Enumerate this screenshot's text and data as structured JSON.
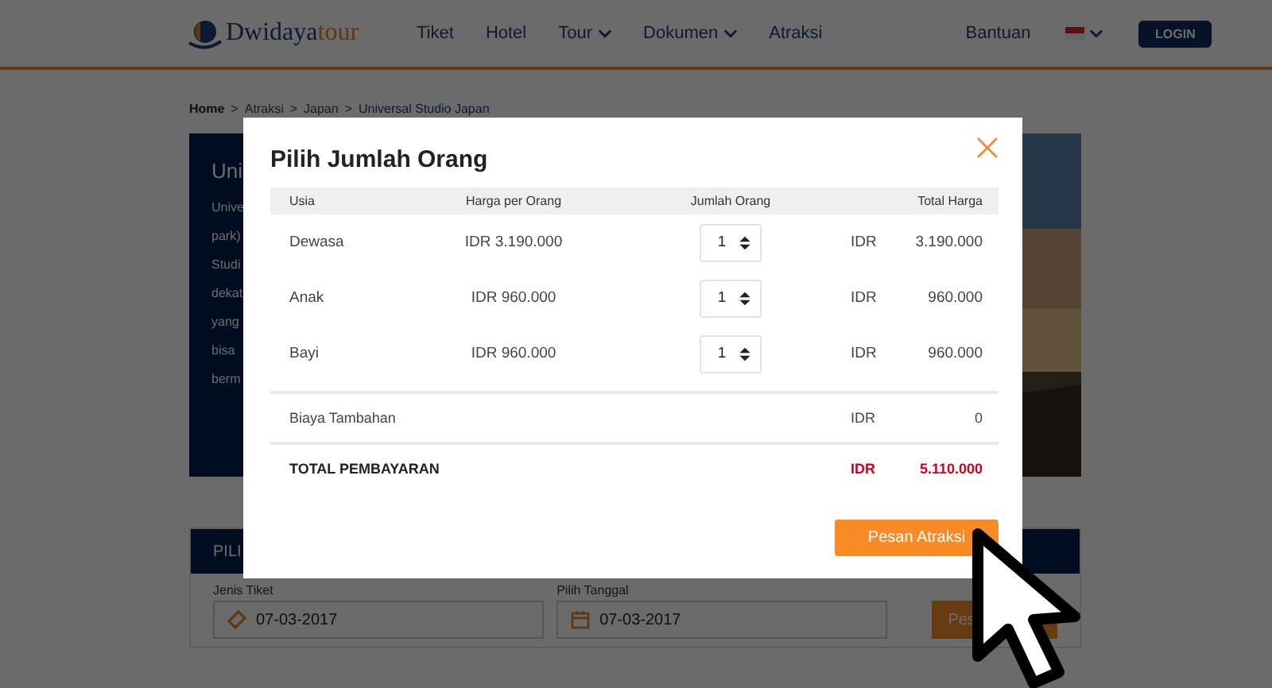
{
  "header": {
    "logo": {
      "part1": "Dwidaya",
      "part2": "tour"
    },
    "nav": [
      {
        "label": "Tiket",
        "dropdown": false
      },
      {
        "label": "Hotel",
        "dropdown": false
      },
      {
        "label": "Tour",
        "dropdown": true
      },
      {
        "label": "Dokumen",
        "dropdown": true
      },
      {
        "label": "Atraksi",
        "dropdown": false
      }
    ],
    "help": "Bantuan",
    "login": "LOGIN"
  },
  "breadcrumb": [
    {
      "label": "Home",
      "current": false
    },
    {
      "label": "Atraksi",
      "current": false
    },
    {
      "label": "Japan",
      "current": false
    },
    {
      "label": "Universal Studio Japan",
      "current": true
    }
  ],
  "breadcrumb_separator": ">",
  "hero": {
    "title": "Uni",
    "lines": [
      "Unive",
      "park)",
      "Studi",
      "dekat",
      "yang",
      "bisa",
      "berm"
    ]
  },
  "booking": {
    "title": "PILI",
    "ticket_label": "Jenis Tiket",
    "ticket_value": "07-03-2017",
    "date_label": "Pilih Tanggal",
    "date_value": "07-03-2017",
    "button": "Pes"
  },
  "modal": {
    "title": "Pilih Jumlah Orang",
    "columns": [
      "Usia",
      "Harga per Orang",
      "Jumlah Orang",
      "Total Harga"
    ],
    "rows": [
      {
        "age": "Dewasa",
        "price": "IDR 3.190.000",
        "quantity": "1",
        "currency": "IDR",
        "total": "3.190.000"
      },
      {
        "age": "Anak",
        "price": "IDR 960.000",
        "quantity": "1",
        "currency": "IDR",
        "total": "960.000"
      },
      {
        "age": "Bayi",
        "price": "IDR 960.000",
        "quantity": "1",
        "currency": "IDR",
        "total": "960.000"
      }
    ],
    "extra": {
      "label": "Biaya Tambahan",
      "currency": "IDR",
      "value": "0"
    },
    "grand_total": {
      "label": "TOTAL PEMBAYARAN",
      "currency": "IDR",
      "value": "5.110.000"
    },
    "button": "Pesan Atraksi"
  }
}
